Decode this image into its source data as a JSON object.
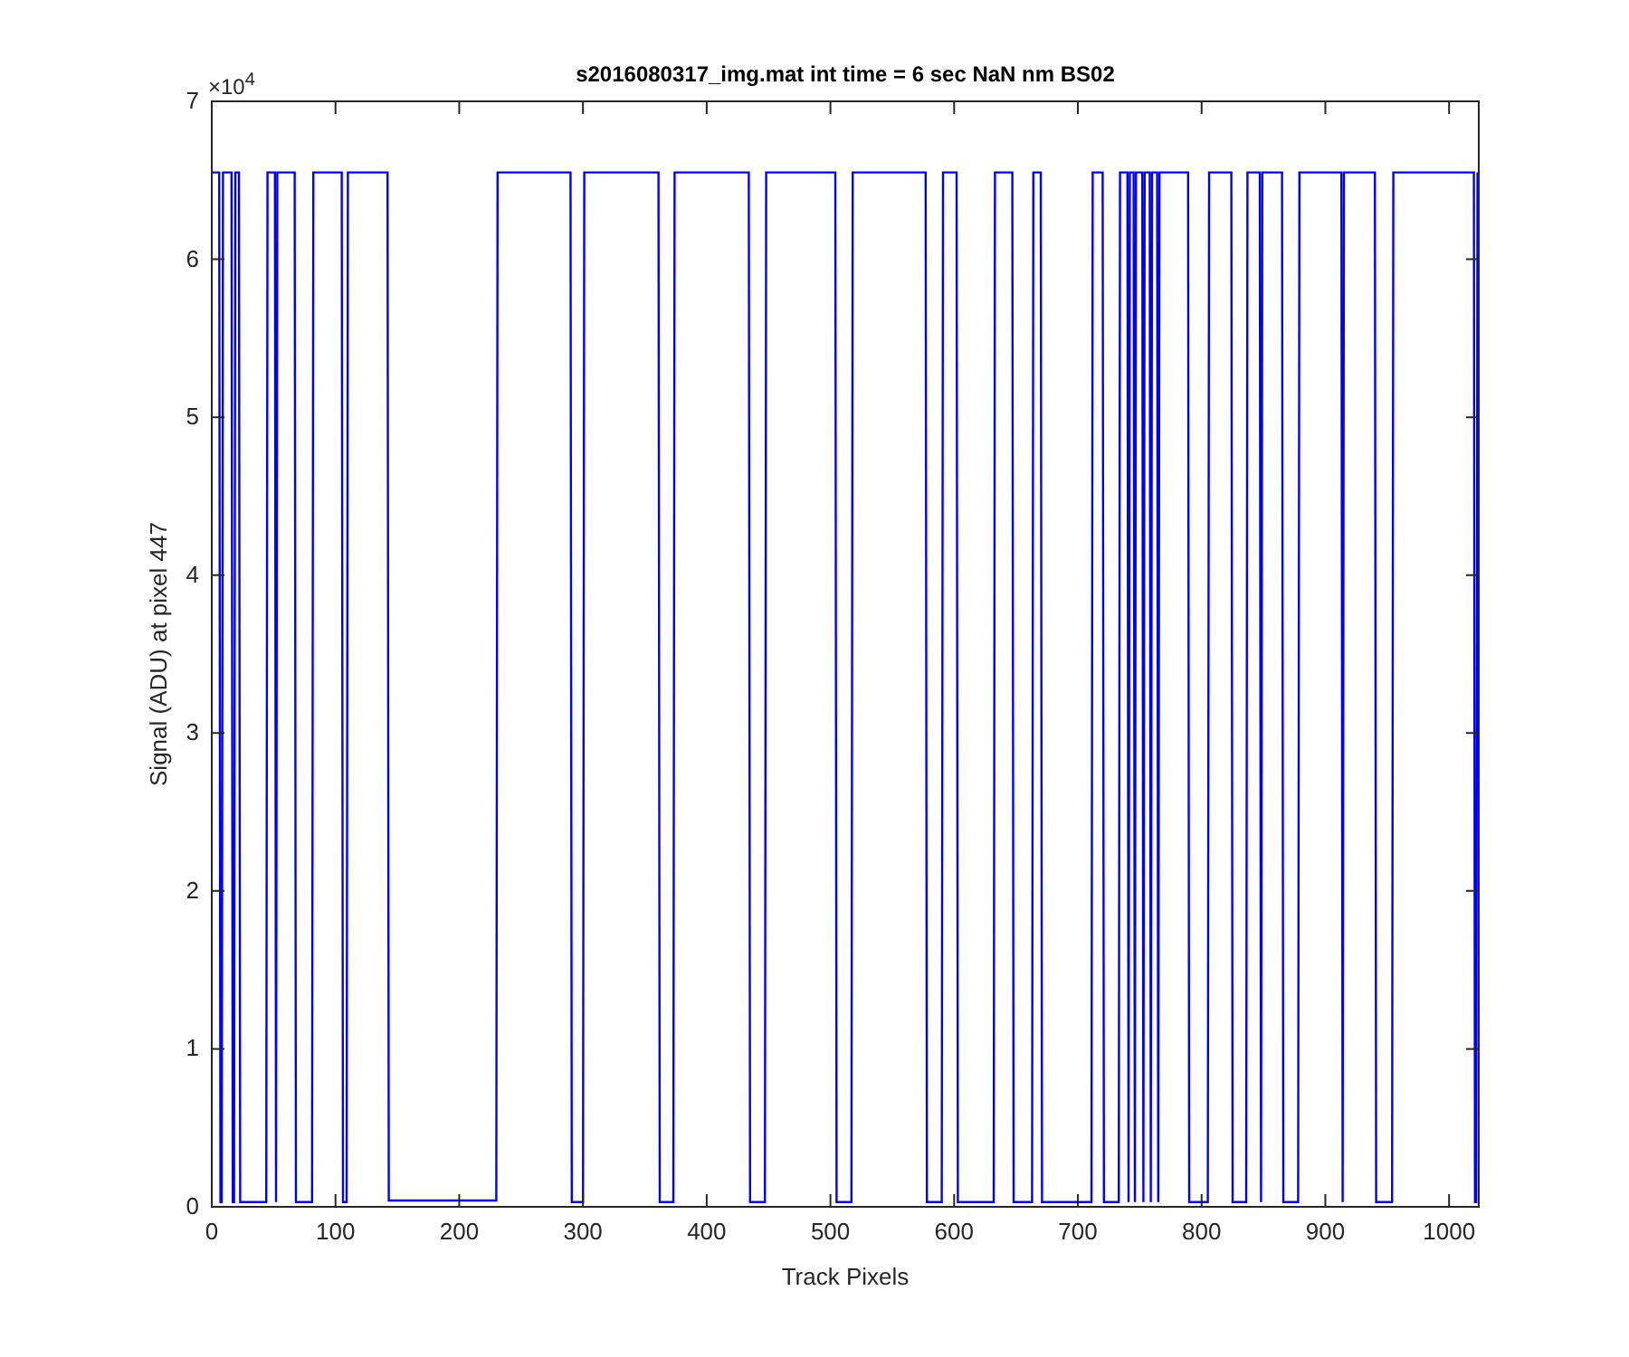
{
  "figure": {
    "axis_multiplier": "×10$^{4}$",
    "chart_data": {
      "type": "line",
      "title": "s2016080317_img.mat int time = 6 sec  NaN nm BS02",
      "xlabel": "Track Pixels",
      "ylabel": "Signal (ADU) at pixel 447",
      "xlim": [
        0,
        1024
      ],
      "ylim": [
        0,
        7
      ],
      "xticks": [
        0,
        100,
        200,
        300,
        400,
        500,
        600,
        700,
        800,
        900,
        1000
      ],
      "yticks": [
        0,
        1,
        2,
        3,
        4,
        5,
        6,
        7
      ],
      "x": [
        0,
        6,
        7,
        8,
        9,
        16,
        17,
        18,
        19,
        22,
        23,
        44,
        45,
        51,
        52,
        53,
        67,
        68,
        81,
        82,
        105,
        106,
        109,
        110,
        142,
        143,
        230,
        231,
        290,
        291,
        300,
        301,
        361,
        362,
        373,
        374,
        434,
        435,
        447,
        448,
        504,
        505,
        517,
        518,
        577,
        578,
        590,
        591,
        602,
        603,
        632,
        633,
        647,
        648,
        663,
        664,
        670,
        671,
        711,
        712,
        720,
        721,
        733,
        734,
        740,
        741,
        742,
        745,
        746,
        747,
        752,
        753,
        754,
        758,
        759,
        760,
        764,
        765,
        766,
        789,
        790,
        805,
        806,
        824,
        825,
        836,
        837,
        847,
        848,
        849,
        865,
        866,
        878,
        879,
        913,
        914,
        915,
        940,
        941,
        954,
        955,
        1020,
        1021,
        1022,
        1023
      ],
      "values": [
        6.55,
        6.55,
        0.03,
        0.03,
        6.55,
        6.55,
        0.03,
        0.03,
        6.55,
        6.55,
        0.03,
        0.03,
        6.55,
        6.55,
        0.03,
        6.55,
        6.55,
        0.03,
        0.03,
        6.55,
        6.55,
        0.03,
        0.03,
        6.55,
        6.55,
        0.04,
        0.04,
        6.55,
        6.55,
        0.03,
        0.03,
        6.55,
        6.55,
        0.03,
        0.03,
        6.55,
        6.55,
        0.03,
        0.03,
        6.55,
        6.55,
        0.03,
        0.03,
        6.55,
        6.55,
        0.03,
        0.03,
        6.55,
        6.55,
        0.03,
        0.03,
        6.55,
        6.55,
        0.03,
        0.03,
        6.55,
        6.55,
        0.03,
        0.03,
        6.55,
        6.55,
        0.03,
        0.03,
        6.55,
        6.55,
        0.03,
        6.55,
        6.55,
        0.03,
        6.55,
        6.55,
        0.03,
        6.55,
        6.55,
        0.03,
        6.55,
        6.55,
        0.03,
        6.55,
        6.55,
        0.03,
        0.03,
        6.55,
        6.55,
        0.03,
        0.03,
        6.55,
        6.55,
        0.03,
        6.55,
        6.55,
        0.03,
        0.03,
        6.55,
        6.55,
        0.03,
        6.55,
        6.55,
        0.03,
        0.03,
        6.55,
        6.55,
        0.03,
        0.03,
        6.55
      ]
    }
  }
}
